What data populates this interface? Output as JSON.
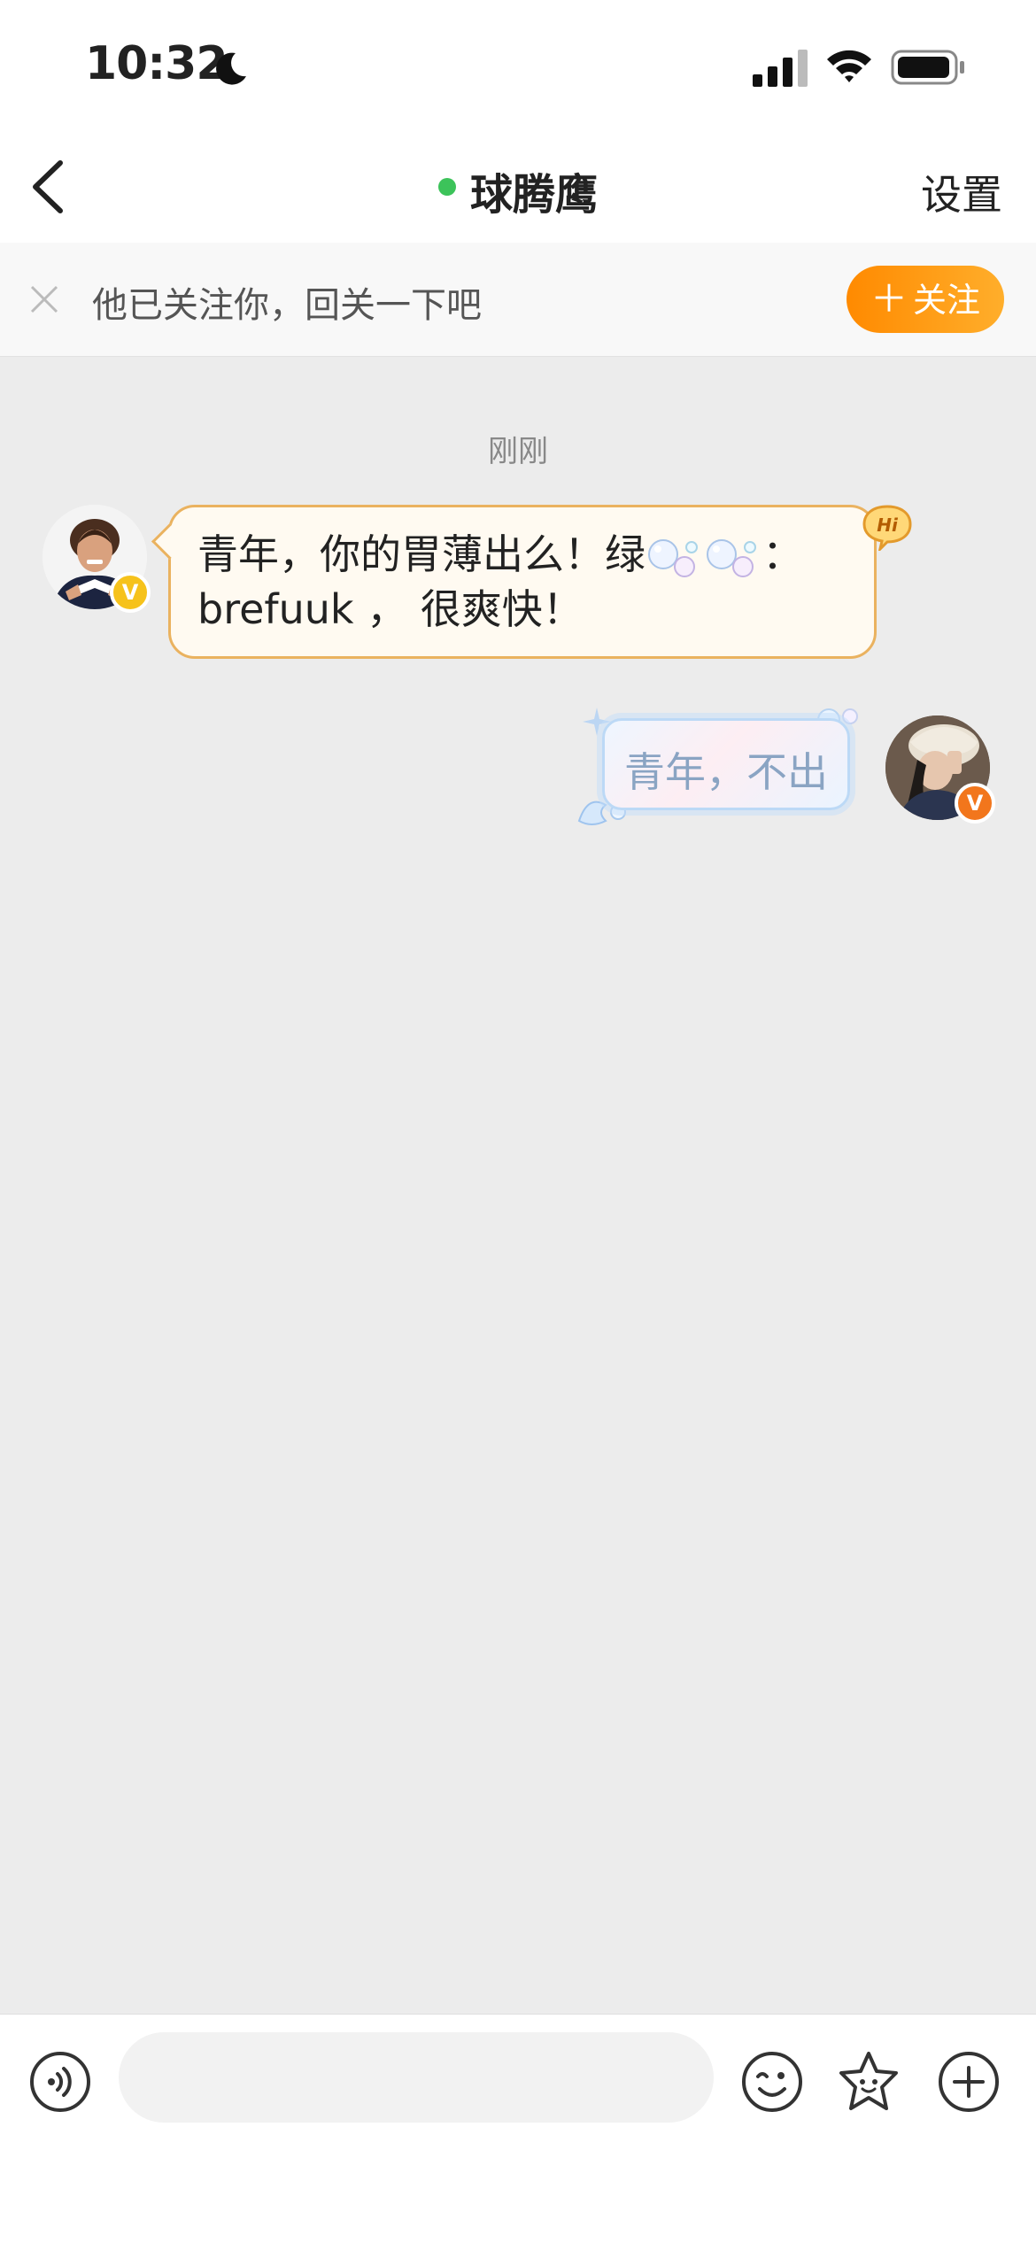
{
  "status_bar": {
    "time": "10:32",
    "icons": [
      "moon-icon",
      "cellular-signal-icon",
      "wifi-icon",
      "battery-icon"
    ]
  },
  "nav": {
    "back_icon": "chevron-left-icon",
    "title": "球腾鹰",
    "online_color": "#3cc35a",
    "settings_label": "设置"
  },
  "follow_prompt": {
    "close_icon": "close-icon",
    "text": "他已关注你，回关一下吧",
    "button_plus": "＋",
    "button_label": "关注",
    "button_color": "#ff8a00"
  },
  "chat": {
    "timestamp": "刚刚",
    "messages": [
      {
        "side": "left",
        "avatar_badge": "V",
        "badge_color": "#f6c21b",
        "text_part1": "青年，你的胃薄出么！绿",
        "emoji": "bubbles",
        "text_part2": "：",
        "text_line2": "brefuuk ， 很爽快！",
        "decoration": "Hi"
      },
      {
        "side": "right",
        "avatar_badge": "V",
        "badge_color": "#f2761c",
        "text": "青年，不出"
      }
    ]
  },
  "input_bar": {
    "voice_icon": "voice-icon",
    "placeholder": "",
    "emoji_icon": "emoji-icon",
    "sticker_icon": "sticker-icon",
    "plus_icon": "plus-circle-icon"
  }
}
